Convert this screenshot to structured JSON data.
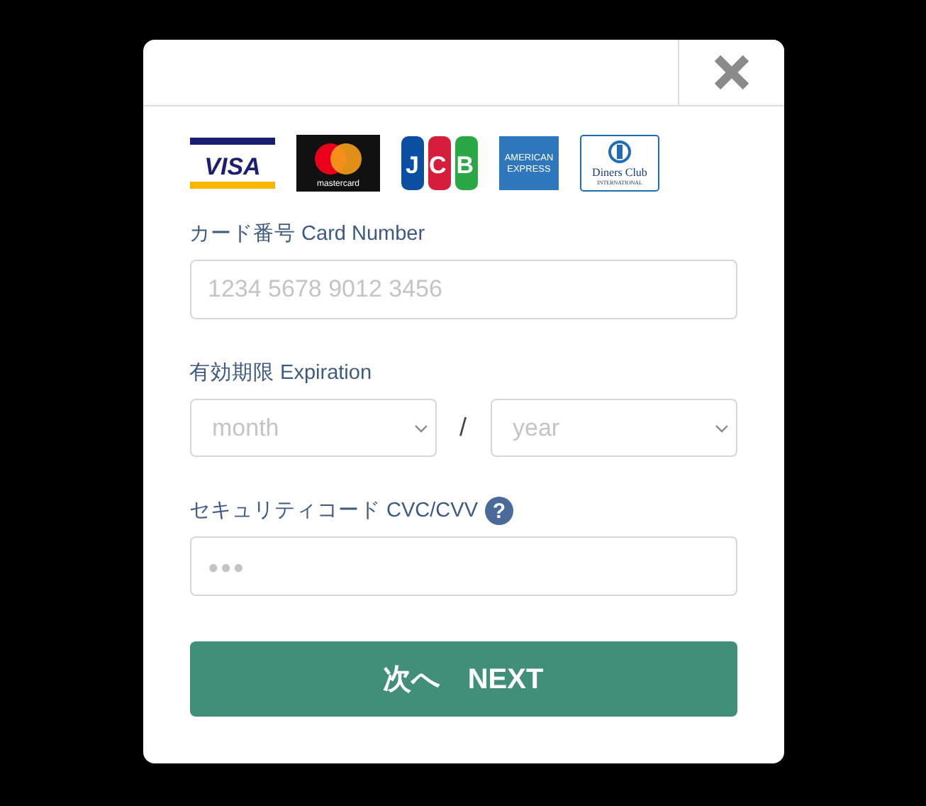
{
  "cards": [
    {
      "kind": "visa",
      "lines": [
        "VISA"
      ]
    },
    {
      "kind": "mastercard",
      "lines": [
        "mastercard"
      ]
    },
    {
      "kind": "jcb",
      "lines": [
        "JCB"
      ]
    },
    {
      "kind": "amex",
      "lines": [
        "AMERICAN",
        "EXPRESS"
      ]
    },
    {
      "kind": "diners",
      "lines": [
        "Diners Club",
        "INTERNATIONAL"
      ]
    }
  ],
  "card_number": {
    "label": "カード番号 Card Number",
    "placeholder": "1234 5678 9012 3456"
  },
  "expiration": {
    "label": "有効期限 Expiration",
    "month": {
      "placeholder": "month"
    },
    "separator": "/",
    "year": {
      "placeholder": "year"
    }
  },
  "security_code": {
    "label": "セキュリティコード CVC/CVV",
    "help": "?",
    "placeholder": "●●●"
  },
  "next_button": "次へ　NEXT"
}
